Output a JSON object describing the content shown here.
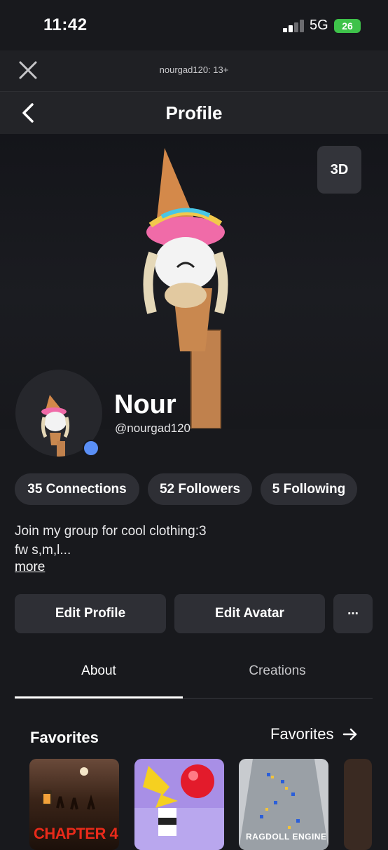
{
  "status_bar": {
    "time": "11:42",
    "network": "5G",
    "battery": "26"
  },
  "top_bar": {
    "site_label": "nourgad120: 13+"
  },
  "nav": {
    "title": "Profile"
  },
  "hero": {
    "button_3d": "3D"
  },
  "profile": {
    "display_name": "Nour",
    "username": "@nourgad120"
  },
  "stats": [
    {
      "label": "35 Connections"
    },
    {
      "label": "52 Followers"
    },
    {
      "label": "5 Following"
    }
  ],
  "bio": {
    "line1": "Join my group for cool clothing:3",
    "line2": "fw s,m,l...",
    "more": "more"
  },
  "actions": {
    "edit_profile": "Edit Profile",
    "edit_avatar": "Edit Avatar",
    "more_label": "..."
  },
  "tabs": [
    {
      "label": "About",
      "active": true
    },
    {
      "label": "Creations",
      "active": false
    }
  ],
  "favorites": {
    "title": "Favorites",
    "link": "Favorites",
    "items": [
      {
        "caption": "CHAPTER 4"
      },
      {
        "caption": ""
      },
      {
        "caption": "RAGDOLL ENGINE"
      },
      {
        "caption": ""
      }
    ]
  },
  "colors": {
    "background": "#18191d",
    "pill": "#2e2f35",
    "online": "#5a8ff6",
    "battery": "#3ec24a"
  }
}
